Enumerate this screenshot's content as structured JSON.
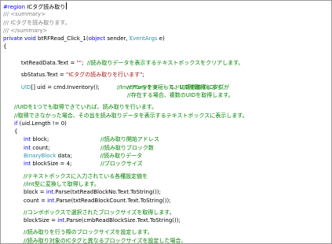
{
  "code": {
    "region_kw": "#region",
    "region_name": " ICタグ読み取り",
    "doc1": "/// <summary>",
    "doc2": "/// ICタグを読み取ります。",
    "doc3": "/// </summary>",
    "sig_mod": "private void",
    "sig_name": " btRFRead_Click_1(",
    "sig_obj": "object",
    "sig_sender": " sender, ",
    "sig_evt": "EventArgs",
    "sig_e": " e)",
    "open_brace": "{",
    "l1_code": "txtReadData.Text = ",
    "l1_str": "\"\"",
    "l1_sep": ";  ",
    "l1_cm": "//読み取りデータを表示するテキストボックスをクリアします。",
    "l2_code": "sbStatus.Text = ",
    "l2_str": "\"ICタグの読み取りを行います\"",
    "l2_end": ";",
    "l3_kw": "UID",
    "l3_code": "[] uid = cmd.Inventory();",
    "l3_cm": "//Inventoryを実行して、UIDを取得します。",
    "l3_cm2": "//アンテナフィールドに複数枚のICタグが",
    "l3_cm3": "//存在する場合、複数のUIDを取得します。",
    "cm_a": "//UIDを1つでも取得できていれば、読み取りを行います。",
    "cm_b": "//取得できなかった場合、その旨を読み取りデータを表示するテキストボックスに表示します。",
    "if_kw": "if",
    "if_code": " (uid.Length != 0)",
    "inner_brace": "{",
    "v1_kw": "int",
    "v1_code": " block;",
    "v1_cm": "//読み取り開始アドレス",
    "v2_kw": "int",
    "v2_code": " count;",
    "v2_cm": "//読み取りブロック数",
    "v3_typ": "BinaryBlock",
    "v3_code": " data;",
    "v3_cm": "//読み取りデータ",
    "v4_kw": "int",
    "v4_code": " blockSize = 4;",
    "v4_cm": "//ブロックサイズ",
    "c1": "//テキストボックスに入力されている各種設定値を",
    "c2_kw": "//int",
    "c2_rest": "型に変換して取得します。",
    "p1_a": "block = ",
    "p1_kw": "int",
    "p1_b": ".Parse(txtReadBlockNo.Text.ToString());",
    "p2_a": "count = ",
    "p2_kw": "int",
    "p2_b": ".Parse(txtReadBlockCount.Text.ToString());",
    "c3": "//コンボボックスで選択されたブロックサイズを取得します。",
    "p3_a": "blockSize = ",
    "p3_kw": "int",
    "p3_b": ".Parse(cmbReadBlockSize.Text.ToString());",
    "c4": "//読み取りを行う際のブロックサイズを設定します。",
    "c5": "//読み取り対象のICタグと異なるブロックサイズを設定した場合、"
  }
}
